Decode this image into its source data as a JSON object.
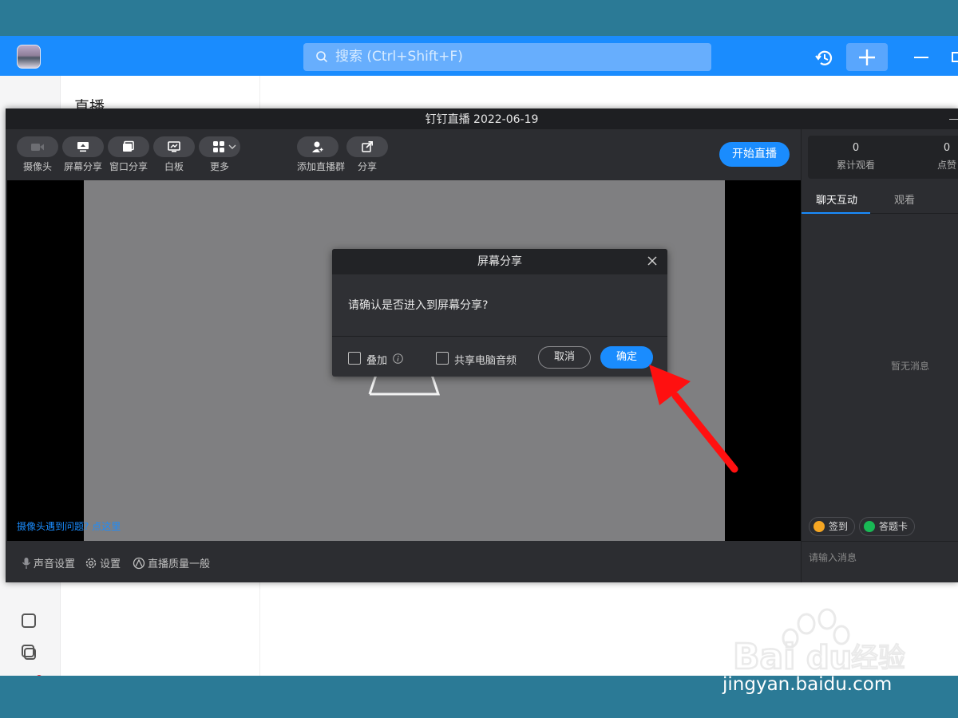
{
  "app": {
    "search_placeholder": "搜索 (Ctrl+Shift+F)",
    "mid_title": "直播"
  },
  "live_window": {
    "title": "钉钉直播 2022-06-19",
    "toolbar": [
      {
        "id": "camera",
        "label": "摄像头",
        "icon": "camera-icon"
      },
      {
        "id": "screen-share",
        "label": "屏幕分享",
        "icon": "screen-share-icon"
      },
      {
        "id": "window-share",
        "label": "窗口分享",
        "icon": "window-share-icon"
      },
      {
        "id": "whiteboard",
        "label": "白板",
        "icon": "whiteboard-icon"
      },
      {
        "id": "more",
        "label": "更多",
        "icon": "grid-icon"
      },
      {
        "id": "add-group",
        "label": "添加直播群",
        "icon": "add-group-icon"
      },
      {
        "id": "share",
        "label": "分享",
        "icon": "share-icon"
      }
    ],
    "start_button": "开始直播",
    "camera_help": {
      "prefix": "摄像头遇到问题?",
      "link": "点这里"
    },
    "bottom_bar": {
      "audio_settings": "声音设置",
      "settings": "设置",
      "quality": "直播质量一般"
    },
    "side": {
      "stats": [
        {
          "value": "0",
          "label": "累计观看"
        },
        {
          "value": "0",
          "label": "点赞"
        }
      ],
      "tabs": [
        "聊天互动",
        "观看"
      ],
      "empty_message": "暂无消息",
      "chips": [
        "签到",
        "答题卡"
      ],
      "input_placeholder": "请输入消息"
    }
  },
  "dialog": {
    "title": "屏幕分享",
    "message": "请确认是否进入到屏幕分享?",
    "overlay_label": "叠加",
    "share_audio_label": "共享电脑音频",
    "cancel": "取消",
    "confirm": "确定"
  },
  "watermark": {
    "brand": "Baidu 经验",
    "url": "jingyan.baidu.com"
  },
  "colors": {
    "accent": "#1a8cfe",
    "titlebar": "#1a8cfe",
    "dark_bg": "#2c2d31",
    "annotation_arrow": "#ff1010"
  }
}
